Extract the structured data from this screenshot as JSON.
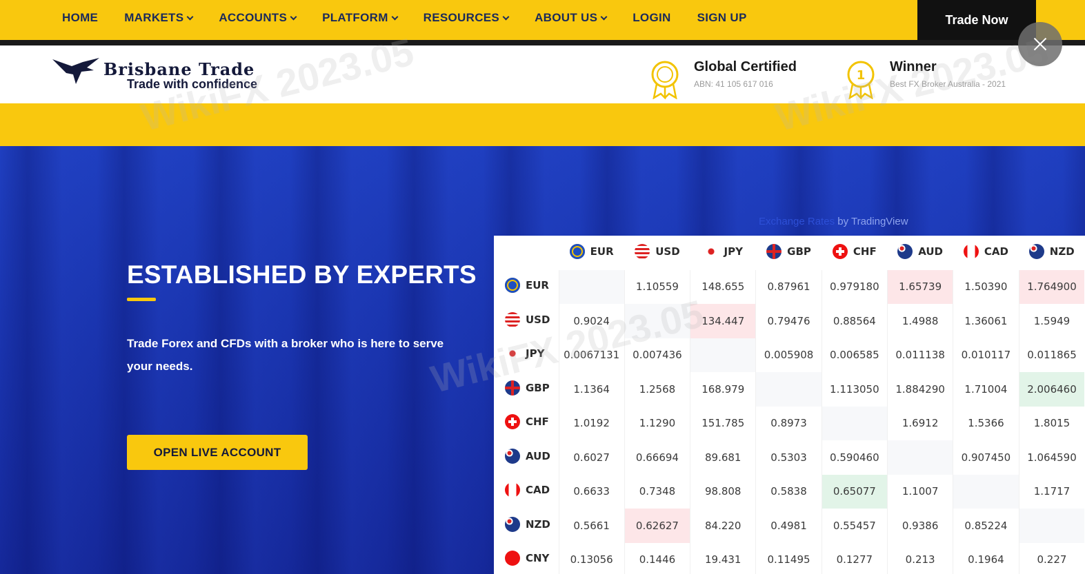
{
  "nav": {
    "items": [
      {
        "label": "HOME",
        "dropdown": false
      },
      {
        "label": "MARKETS",
        "dropdown": true
      },
      {
        "label": "ACCOUNTS",
        "dropdown": true
      },
      {
        "label": "PLATFORM",
        "dropdown": true
      },
      {
        "label": "RESOURCES",
        "dropdown": true
      },
      {
        "label": "ABOUT US",
        "dropdown": true
      },
      {
        "label": "LOGIN",
        "dropdown": false
      },
      {
        "label": "SIGN UP",
        "dropdown": false
      }
    ],
    "cta_label": "Trade Now"
  },
  "logo": {
    "name": "Brisbane Trade",
    "tagline": "Trade with confidence"
  },
  "badges": [
    {
      "icon": "certificate-medal-icon",
      "title": "Global Certified",
      "subtitle": "ABN: 41 105 617 016"
    },
    {
      "icon": "winner-medal-icon",
      "title": "Winner",
      "subtitle": "Best FX Broker Australia - 2021"
    }
  ],
  "hero": {
    "title": "ESTABLISHED BY EXPERTS",
    "description": "Trade Forex and CFDs with a broker who is here to serve your needs.",
    "cta_label": "OPEN LIVE ACCOUNT"
  },
  "widget_credit": {
    "link": "Exchange Rates",
    "suffix": " by TradingView"
  },
  "rates": {
    "columns": [
      "EUR",
      "USD",
      "JPY",
      "GBP",
      "CHF",
      "AUD",
      "CAD",
      "NZD"
    ],
    "rows": [
      {
        "currency": "EUR",
        "values": [
          "",
          "1.10559",
          "148.655",
          "0.87961",
          "0.979180",
          "1.65739",
          "1.50390",
          "1.764900"
        ],
        "highlight": {
          "5": "pink",
          "7": "pink"
        }
      },
      {
        "currency": "USD",
        "values": [
          "0.9024",
          "",
          "134.447",
          "0.79476",
          "0.88564",
          "1.4988",
          "1.36061",
          "1.5949"
        ],
        "highlight": {
          "2": "pink"
        }
      },
      {
        "currency": "JPY",
        "values": [
          "0.0067131",
          "0.007436",
          "",
          "0.005908",
          "0.006585",
          "0.011138",
          "0.010117",
          "0.011865"
        ],
        "highlight": {}
      },
      {
        "currency": "GBP",
        "values": [
          "1.1364",
          "1.2568",
          "168.979",
          "",
          "1.113050",
          "1.884290",
          "1.71004",
          "2.006460"
        ],
        "highlight": {
          "7": "green"
        }
      },
      {
        "currency": "CHF",
        "values": [
          "1.0192",
          "1.1290",
          "151.785",
          "0.8973",
          "",
          "1.6912",
          "1.5366",
          "1.8015"
        ],
        "highlight": {}
      },
      {
        "currency": "AUD",
        "values": [
          "0.6027",
          "0.66694",
          "89.681",
          "0.5303",
          "0.590460",
          "",
          "0.907450",
          "1.064590"
        ],
        "highlight": {}
      },
      {
        "currency": "CAD",
        "values": [
          "0.6633",
          "0.7348",
          "98.808",
          "0.5838",
          "0.65077",
          "1.1007",
          "",
          "1.1717"
        ],
        "highlight": {
          "4": "green"
        }
      },
      {
        "currency": "NZD",
        "values": [
          "0.5661",
          "0.62627",
          "84.220",
          "0.4981",
          "0.55457",
          "0.9386",
          "0.85224",
          ""
        ],
        "highlight": {
          "1": "pink"
        }
      },
      {
        "currency": "CNY",
        "values": [
          "0.13056",
          "0.1446",
          "19.431",
          "0.11495",
          "0.1277",
          "0.213",
          "0.1964",
          "0.227"
        ],
        "highlight": {}
      }
    ]
  },
  "watermark": {
    "brand": "WikiFX",
    "date": "2023.05"
  },
  "colors": {
    "brand_yellow": "#f9c80e",
    "nav_text": "#1b2a5a",
    "hero_blue": "#1a35b0",
    "cell_pink": "#fde6e8",
    "cell_green": "#e2f4e8"
  }
}
